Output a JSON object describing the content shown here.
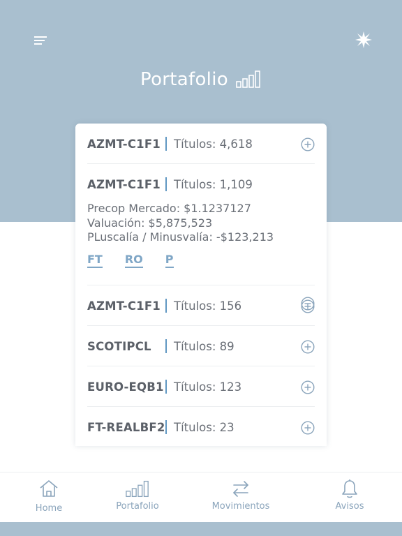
{
  "header": {
    "title": "Portafolio",
    "menu_icon": "hamburger-menu-icon",
    "settings_icon": "star-burst-icon",
    "title_icon": "bar-chart-icon",
    "bg_color": "#a9bfcf"
  },
  "holdings": [
    {
      "ticker": "AZMT-C1F1",
      "titulos": "Títulos: 4,618",
      "expanded": false
    },
    {
      "ticker": "AZMT-C1F1",
      "titulos": "Títulos: 1,109",
      "expanded": true,
      "precop": "Precop Mercado: $1.1237127",
      "valuacion": "Valuación: $5,875,523",
      "plusvalia": "PLuscalía / Minusvalía: -$123,213",
      "links": [
        "FT",
        "RO",
        "P"
      ]
    },
    {
      "ticker": "AZMT-C1F1",
      "titulos": "Títulos: 156",
      "expanded": false
    },
    {
      "ticker": "SCOTIPCL",
      "titulos": "Títulos: 89",
      "expanded": false
    },
    {
      "ticker": "EURO-EQB1",
      "titulos": "Títulos: 123",
      "expanded": false
    },
    {
      "ticker": "FT-REALBF2",
      "titulos": "Títulos: 23",
      "expanded": false
    }
  ],
  "tabbar": {
    "items": [
      {
        "label": "Home",
        "icon": "home-icon"
      },
      {
        "label": "Portafolio",
        "icon": "bar-chart-icon"
      },
      {
        "label": "Movimientos",
        "icon": "transfer-arrows-icon"
      },
      {
        "label": "Avisos",
        "icon": "bell-icon"
      }
    ]
  },
  "colors": {
    "accent": "#5f97c2",
    "link": "#7fa6c6",
    "text": "#5b6068",
    "icon": "#8aa4bb"
  }
}
